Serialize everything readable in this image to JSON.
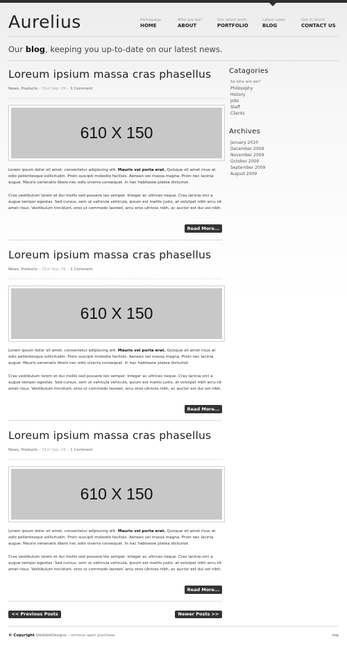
{
  "site": {
    "logo": "Aurelius"
  },
  "nav": [
    {
      "sub": "Homepage",
      "label": "HOME"
    },
    {
      "sub": "Who are we?",
      "label": "ABOUT"
    },
    {
      "sub": "Our latest work",
      "label": "PORTFOLIO"
    },
    {
      "sub": "Latest news",
      "label": "BLOG"
    },
    {
      "sub": "Get in touch",
      "label": "CONTACT US"
    }
  ],
  "tagline": {
    "pre": "Our ",
    "bold": "blog",
    "post": ", keeping you up-to-date on our latest news."
  },
  "posts": [
    {
      "title": "Loreum ipsium massa cras phasellus",
      "categories": "News, Products",
      "date": "31st Sep, 09",
      "comments": "1 Comment",
      "image_label": "610 X 150",
      "p1_a": "Lorem ipsum dolor sit amet, consectetur adipiscing elit. ",
      "p1_bold": "Mauris vel porta erat.",
      "p1_b": " Quisque sit amet risus at odio pellentesque sollicitudin. Proin suscipit molestie facilisis. Aenean vel massa magna. Proin nec lacinia augue. Mauris venenatis libero nec odio viverra consequat. In hac habitasse platea dictumst.",
      "p2": "Cras vestibulum lorem et dui mollis sed posuere leo semper. Integer ac ultrices neque. Cras lacinia orci a augue tempor egestas. Sed cursus, sem ut vehicula vehicula, ipsum est mattis justo, at volutpat nibh arcu sit amet risus. Vestibulum tincidunt, eros ut commodo laoreet, arcu eros ultrices nibh, ac auctor est dui vel nibh.",
      "read_more": "Read More..."
    },
    {
      "title": "Loreum ipsium massa cras phasellus",
      "categories": "News, Products",
      "date": "31st Sep, 09",
      "comments": "1 Comment",
      "image_label": "610 X 150",
      "p1_a": "Lorem ipsum dolor sit amet, consectetur adipiscing elit. ",
      "p1_bold": "Mauris vel porta erat.",
      "p1_b": " Quisque sit amet risus at odio pellentesque sollicitudin. Proin suscipit molestie facilisis. Aenean vel massa magna. Proin nec lacinia augue. Mauris venenatis libero nec odio viverra consequat. In hac habitasse platea dictumst.",
      "p2": "Cras vestibulum lorem et dui mollis sed posuere leo semper. Integer ac ultrices neque. Cras lacinia orci a augue tempor egestas. Sed cursus, sem ut vehicula vehicula, ipsum est mattis justo, at volutpat nibh arcu sit amet risus. Vestibulum tincidunt, eros ut commodo laoreet, arcu eros ultrices nibh, ac auctor est dui vel nibh.",
      "read_more": "Read More..."
    },
    {
      "title": "Loreum ipsium massa cras phasellus",
      "categories": "News, Products",
      "date": "31st Sep, 09",
      "comments": "1 Comment",
      "image_label": "610 X 150",
      "p1_a": "Lorem ipsum dolor sit amet, consectetur adipiscing elit. ",
      "p1_bold": "Mauris vel porta erat.",
      "p1_b": " Quisque sit amet risus at odio pellentesque sollicitudin. Proin suscipit molestie facilisis. Aenean vel massa magna. Proin nec lacinia augue. Mauris venenatis libero nec odio viverra consequat. In hac habitasse platea dictumst.",
      "p2": "Cras vestibulum lorem et dui mollis sed posuere leo semper. Integer ac ultrices neque. Cras lacinia orci a augue tempor egestas. Sed cursus, sem ut vehicula vehicula, ipsum est mattis justo, at volutpat nibh arcu sit amet risus. Vestibulum tincidunt, eros ut commodo laoreet, arcu eros ultrices nibh, ac auctor est dui vel nibh.",
      "read_more": "Read More..."
    }
  ],
  "sidebar": {
    "categories_title": "Catagories",
    "categories": [
      "So who are we?",
      "Philosophy",
      "History",
      "Jobs",
      "Staff",
      "Clients"
    ],
    "archives_title": "Archives",
    "archives": [
      "January 2010",
      "December 2009",
      "November 2009",
      "October 2009",
      "September 2009",
      "August 2009"
    ]
  },
  "pagination": {
    "prev": "<< Previous Posts",
    "next": "Newer Posts >>"
  },
  "footer": {
    "copyright": "© Copyright",
    "brand": "QwibbleDesigns",
    "rest": " – remove upon purchase.",
    "top": "top"
  }
}
